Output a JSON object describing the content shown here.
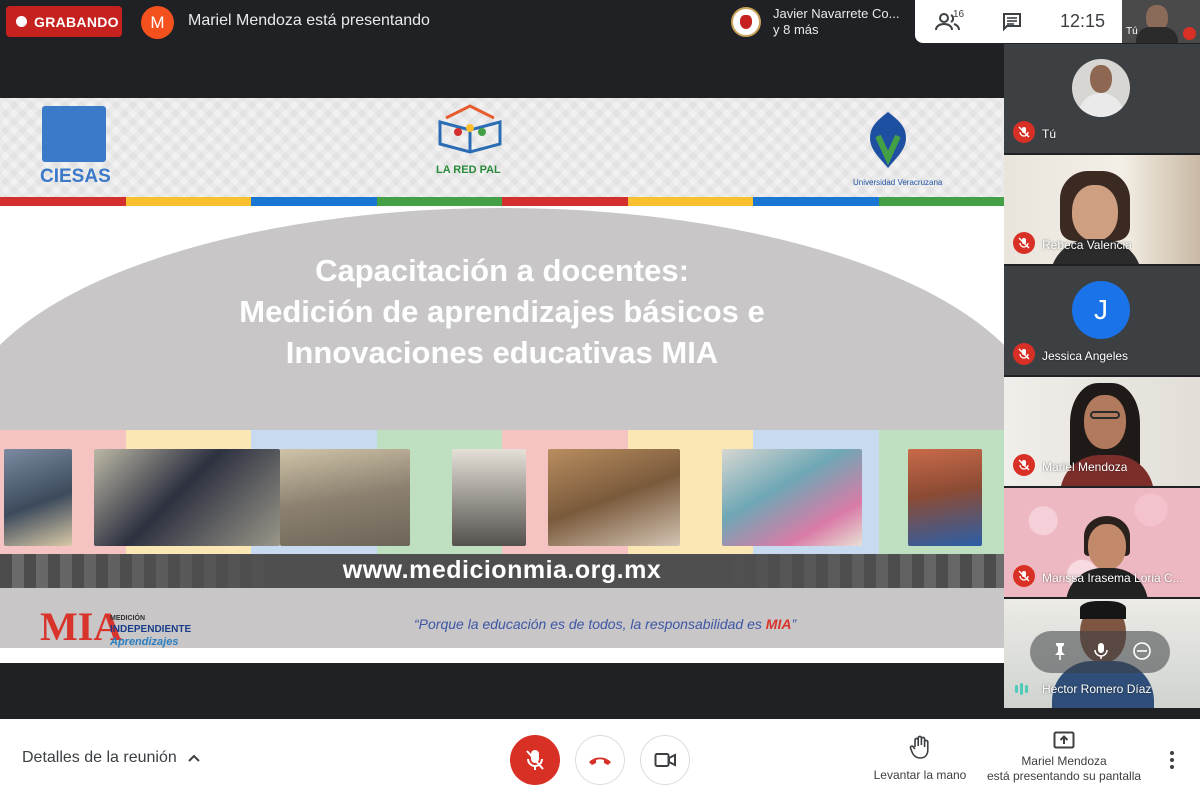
{
  "recording": {
    "label": "GRABANDO"
  },
  "presenter": {
    "initial": "M",
    "text": "Mariel Mendoza está presentando"
  },
  "participants_chip": {
    "name": "Javier Navarrete Co...",
    "more": "y 8 más"
  },
  "toolbar": {
    "people_count": "16",
    "time": "12:15",
    "self_label": "Tú"
  },
  "slide": {
    "logos": {
      "left": "CIESAS",
      "center": "LA RED PAL",
      "right": "Universidad Veracruzana"
    },
    "title_lines": [
      "Capacitación a docentes:",
      "Medición de aprendizajes básicos e",
      "Innovaciones educativas MIA"
    ],
    "url": "www.medicionmia.org.mx",
    "mia_logo": {
      "brand": "MIA",
      "line1": "MEDICIÓN",
      "line2": "INDEPENDIENTE",
      "line3": "Aprendizajes"
    },
    "quote_prefix": "“Porque la educación es de todos, la responsabilidad es ",
    "quote_highlight": "MIA",
    "quote_suffix": "”"
  },
  "participants": [
    {
      "name": "Tú",
      "muted": true,
      "type": "avatar-photo"
    },
    {
      "name": "Rebeca Valencia",
      "muted": true,
      "type": "video"
    },
    {
      "name": "Jessica Angeles",
      "muted": true,
      "type": "letter",
      "initial": "J"
    },
    {
      "name": "Mariel Mendoza",
      "muted": true,
      "type": "video"
    },
    {
      "name": "Marissa Irasema Loria C...",
      "muted": true,
      "type": "video"
    },
    {
      "name": "Hector Romero Díaz",
      "muted": false,
      "type": "video"
    }
  ],
  "bottom": {
    "details_label": "Detalles de la reunión",
    "raise_hand_label": "Levantar la mano",
    "presenting_line1": "Mariel Mendoza",
    "presenting_line2": "está presentando su pantalla"
  },
  "colors": {
    "record_red": "#c5221f",
    "mic_red": "#d93025",
    "accent_blue": "#1a73e8",
    "strip": [
      "#d32f2f",
      "#fbc02d",
      "#1976d2",
      "#43a047",
      "#d32f2f",
      "#fbc02d",
      "#1976d2",
      "#43a047"
    ]
  },
  "icons": [
    "people-icon",
    "chat-icon",
    "mic-off-icon",
    "hang-up-icon",
    "camera-icon",
    "raise-hand-icon",
    "present-screen-icon",
    "more-vert-icon",
    "chevron-up-icon"
  ]
}
